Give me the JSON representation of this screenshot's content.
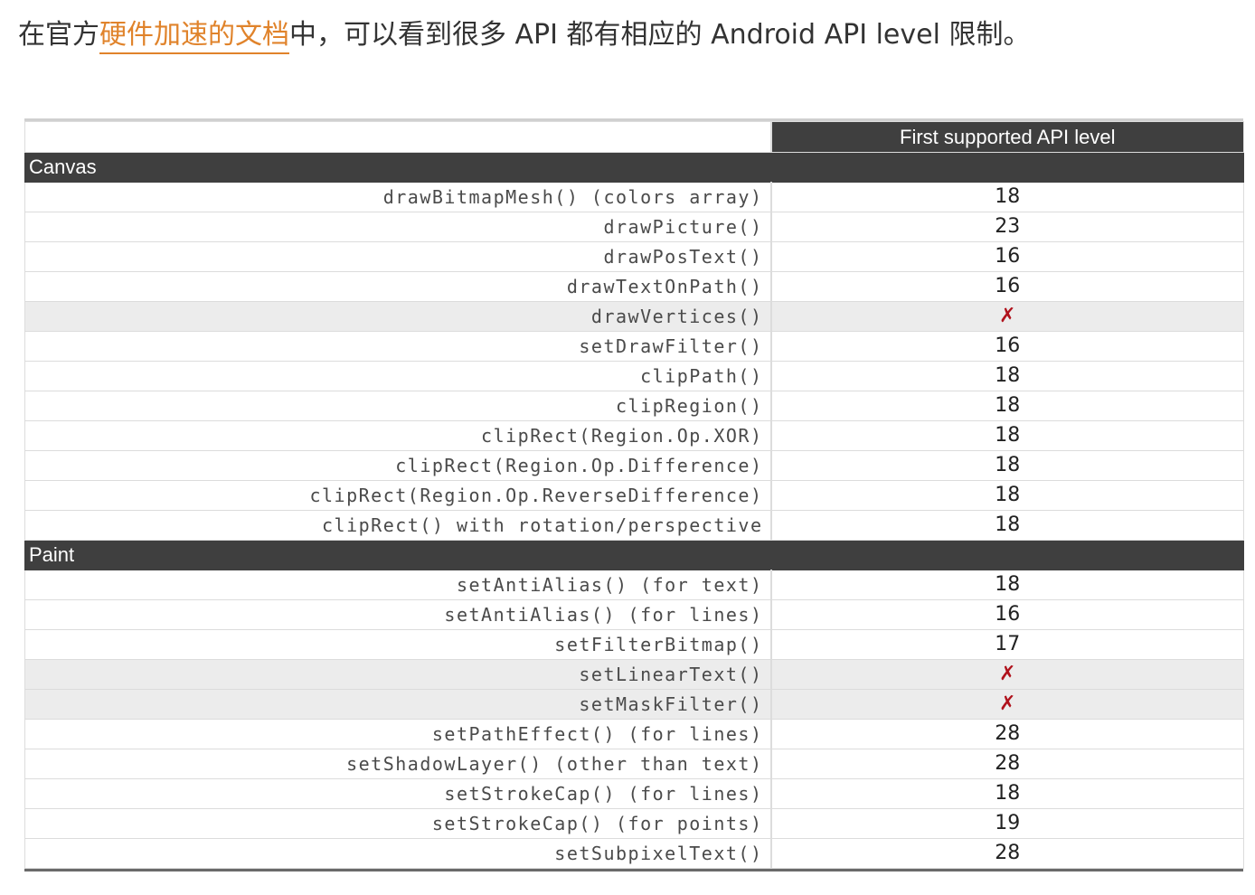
{
  "intro": {
    "before": "在官方",
    "link": "硬件加速的文档",
    "after": "中，可以看到很多 API 都有相应的 Android API level 限制。"
  },
  "table": {
    "header": "First supported API level",
    "sections": [
      {
        "name": "Canvas",
        "rows": [
          {
            "api": "drawBitmapMesh() (colors array)",
            "level": "18",
            "supported": true
          },
          {
            "api": "drawPicture()",
            "level": "23",
            "supported": true
          },
          {
            "api": "drawPosText()",
            "level": "16",
            "supported": true
          },
          {
            "api": "drawTextOnPath()",
            "level": "16",
            "supported": true
          },
          {
            "api": "drawVertices()",
            "level": "✗",
            "supported": false
          },
          {
            "api": "setDrawFilter()",
            "level": "16",
            "supported": true
          },
          {
            "api": "clipPath()",
            "level": "18",
            "supported": true
          },
          {
            "api": "clipRegion()",
            "level": "18",
            "supported": true
          },
          {
            "api": "clipRect(Region.Op.XOR)",
            "level": "18",
            "supported": true
          },
          {
            "api": "clipRect(Region.Op.Difference)",
            "level": "18",
            "supported": true
          },
          {
            "api": "clipRect(Region.Op.ReverseDifference)",
            "level": "18",
            "supported": true
          },
          {
            "api": "clipRect() with rotation/perspective",
            "level": "18",
            "supported": true
          }
        ]
      },
      {
        "name": "Paint",
        "rows": [
          {
            "api": "setAntiAlias() (for text)",
            "level": "18",
            "supported": true
          },
          {
            "api": "setAntiAlias() (for lines)",
            "level": "16",
            "supported": true
          },
          {
            "api": "setFilterBitmap()",
            "level": "17",
            "supported": true
          },
          {
            "api": "setLinearText()",
            "level": "✗",
            "supported": false
          },
          {
            "api": "setMaskFilter()",
            "level": "✗",
            "supported": false
          },
          {
            "api": "setPathEffect() (for lines)",
            "level": "28",
            "supported": true
          },
          {
            "api": "setShadowLayer() (other than text)",
            "level": "28",
            "supported": true
          },
          {
            "api": "setStrokeCap() (for lines)",
            "level": "18",
            "supported": true
          },
          {
            "api": "setStrokeCap() (for points)",
            "level": "19",
            "supported": true
          },
          {
            "api": "setSubpixelText()",
            "level": "28",
            "supported": true
          }
        ]
      }
    ]
  }
}
